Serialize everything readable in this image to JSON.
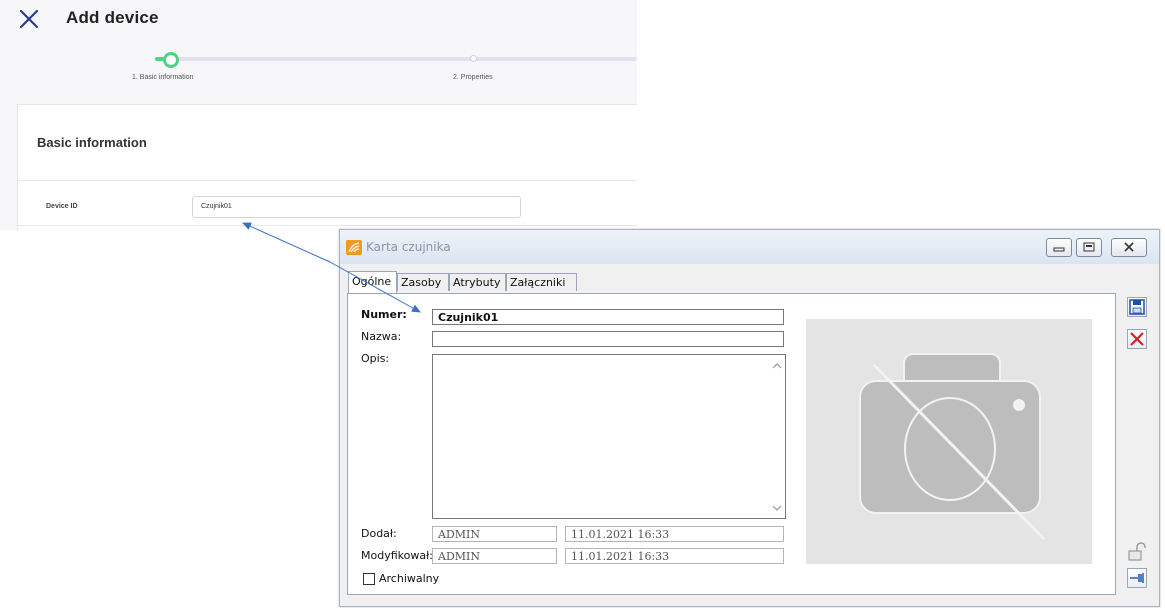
{
  "web": {
    "title": "Add device",
    "steps": [
      {
        "label": "1. Basic information"
      },
      {
        "label": "2. Properties"
      }
    ],
    "section_title": "Basic information",
    "device_id_label": "Device ID",
    "device_id_value": "Czujnik01"
  },
  "window": {
    "title": "Karta czujnika",
    "tabs": [
      "Ogólne",
      "Zasoby",
      "Atrybuty",
      "Załączniki"
    ],
    "fields": {
      "numer_label": "Numer:",
      "numer_value": "Czujnik01",
      "nazwa_label": "Nazwa:",
      "nazwa_value": "",
      "opis_label": "Opis:",
      "dodal_label": "Dodał:",
      "dodal_user": "ADMIN",
      "dodal_date": "11.01.2021 16:33",
      "modyfikowal_label": "Modyfikował:",
      "modyfikowal_user": "ADMIN",
      "modyfikowal_date": "11.01.2021 16:33",
      "archiwalny_label": "Archiwalny"
    },
    "archiwalny_checked": false,
    "colors": {
      "accent_green": "#4cd680",
      "arrow_blue": "#3a6fc4",
      "delete_red": "#d42020"
    },
    "icons": [
      "save-icon",
      "delete-icon",
      "lock-icon",
      "pin-icon",
      "camera-placeholder-icon"
    ]
  }
}
